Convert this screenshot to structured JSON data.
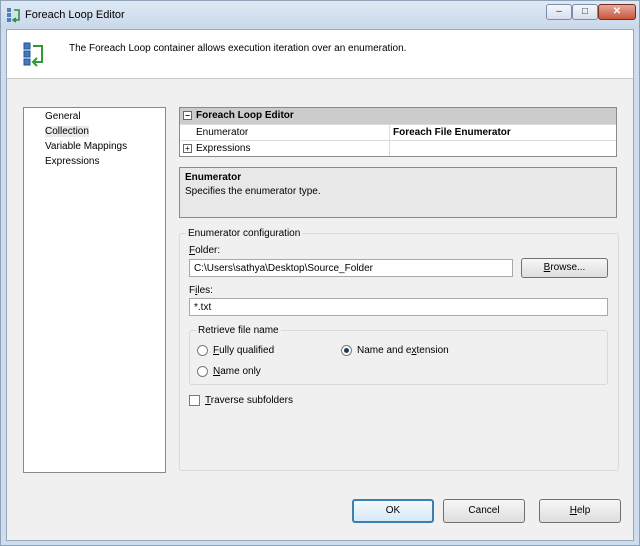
{
  "window": {
    "title": "Foreach Loop Editor",
    "controls": {
      "minimize": "–",
      "maximize": "□",
      "close": "✕"
    }
  },
  "header": {
    "text": "The Foreach Loop container allows execution iteration over an enumeration."
  },
  "nav": {
    "items": [
      "General",
      "Collection",
      "Variable Mappings",
      "Expressions"
    ],
    "selected": "Collection"
  },
  "grid": {
    "header": "Foreach Loop Editor",
    "rows": [
      {
        "name": "Enumerator",
        "value": "Foreach File Enumerator"
      },
      {
        "name": "Expressions",
        "value": ""
      }
    ]
  },
  "description": {
    "title": "Enumerator",
    "text": "Specifies the enumerator type."
  },
  "enumerator_config": {
    "title": "Enumerator configuration",
    "folder_label": "Folder:",
    "folder_value": "C:\\Users\\sathya\\Desktop\\Source_Folder",
    "browse_label": "Browse...",
    "files_label": "Files:",
    "files_value": "*.txt",
    "retrieve": {
      "title": "Retrieve file name",
      "options": [
        "Fully qualified",
        "Name and extension",
        "Name only"
      ],
      "selected": "Name and extension"
    },
    "traverse_label": "Traverse subfolders",
    "traverse_checked": false
  },
  "buttons": {
    "ok": "OK",
    "cancel": "Cancel",
    "help": "Help"
  },
  "colors": {
    "title_bg": "#cfdcec",
    "grid_header": "#cccccc",
    "default_button_border": "#3c7fb1"
  }
}
